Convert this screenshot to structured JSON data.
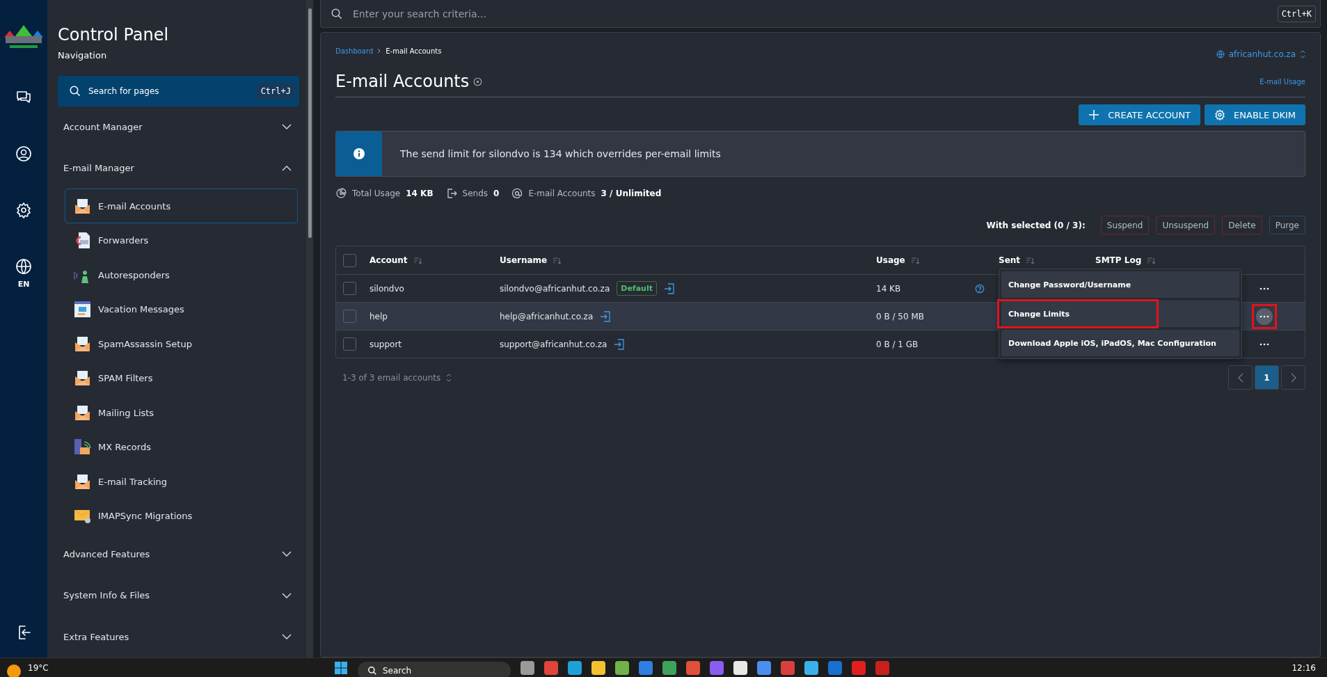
{
  "rail": {
    "language": "EN"
  },
  "sidebar": {
    "title": "Control Panel",
    "subtitle": "Navigation",
    "search": {
      "placeholder": "Search for pages",
      "shortcut": "Ctrl+J"
    },
    "sections": [
      {
        "label": "Account Manager",
        "expanded": false
      },
      {
        "label": "E-mail Manager",
        "expanded": true,
        "children": [
          {
            "label": "E-mail Accounts",
            "kind": "envelope",
            "selected": true
          },
          {
            "label": "Forwarders",
            "kind": "document",
            "selected": false
          },
          {
            "label": "Autoresponders",
            "kind": "person",
            "selected": false
          },
          {
            "label": "Vacation Messages",
            "kind": "calendar",
            "selected": false
          },
          {
            "label": "SpamAssassin Setup",
            "kind": "envelope",
            "selected": false
          },
          {
            "label": "SPAM Filters",
            "kind": "envelope",
            "selected": false
          },
          {
            "label": "Mailing Lists",
            "kind": "envelope",
            "selected": false
          },
          {
            "label": "MX Records",
            "kind": "server",
            "selected": false
          },
          {
            "label": "E-mail Tracking",
            "kind": "envelope",
            "selected": false
          },
          {
            "label": "IMAPSync Migrations",
            "kind": "closed-envelope",
            "selected": false
          }
        ]
      },
      {
        "label": "Advanced Features",
        "expanded": false
      },
      {
        "label": "System Info & Files",
        "expanded": false
      },
      {
        "label": "Extra Features",
        "expanded": false
      }
    ]
  },
  "search": {
    "placeholder": "Enter your search criteria...",
    "shortcut": "Ctrl+K"
  },
  "breadcrumb": [
    "Dashboard",
    "E-mail Accounts"
  ],
  "domain": "africanhut.co.za",
  "title": "E-mail Accounts",
  "usage_link": "E-mail Usage",
  "actions": [
    {
      "label": "CREATE ACCOUNT",
      "kind": "plus"
    },
    {
      "label": "ENABLE DKIM",
      "kind": "gear"
    }
  ],
  "notice": "The send limit for silondvo is 134 which overrides per-email limits",
  "stats": [
    {
      "kind": "pie",
      "label": "Total Usage",
      "value": "14 KB"
    },
    {
      "kind": "send",
      "label": "Sends",
      "value": "0"
    },
    {
      "kind": "at",
      "label": "E-mail Accounts",
      "value": "3 / Unlimited"
    }
  ],
  "bulk": {
    "label": "With selected (0 / 3):",
    "buttons": [
      {
        "label": "Suspend",
        "kind": "danger"
      },
      {
        "label": "Unsuspend",
        "kind": "danger"
      },
      {
        "label": "Delete",
        "kind": "danger"
      },
      {
        "label": "Purge",
        "kind": "primary"
      }
    ]
  },
  "table": {
    "select_all": false,
    "columns": [
      "Account",
      "Username",
      "Usage",
      "Sent",
      "SMTP Log"
    ],
    "rows": [
      {
        "account": "silondvo",
        "username": "silondvo@africanhut.co.za",
        "badge": "Default",
        "usage": "14 KB",
        "sent_info": true,
        "checked": false,
        "hovered": false,
        "menu_open": false,
        "annotated": false
      },
      {
        "account": "help",
        "username": "help@africanhut.co.za",
        "usage": "0 B / 50 MB",
        "sent_info": false,
        "checked": false,
        "hovered": true,
        "menu_open": true,
        "annotated": true
      },
      {
        "account": "support",
        "username": "support@africanhut.co.za",
        "usage": "0 B / 1 GB",
        "sent_info": false,
        "checked": false,
        "hovered": false,
        "menu_open": false,
        "annotated": false
      }
    ]
  },
  "menu": {
    "items": [
      {
        "label": "Change Password/Username",
        "annotated": false
      },
      {
        "label": "Change Limits",
        "annotated": true
      },
      {
        "label": "Download Apple iOS, iPadOS, Mac Configuration",
        "annotated": false
      }
    ]
  },
  "footer": {
    "count": "1-3 of 3 email accounts",
    "pages": [
      {
        "label": "1",
        "selected": true
      }
    ]
  },
  "taskbar": {
    "weather": "19°C",
    "search": "Search",
    "time": "12:16",
    "apps": [
      {
        "color": "#9a9a9a"
      },
      {
        "color": "#e0443a"
      },
      {
        "color": "#1fa0d8"
      },
      {
        "color": "#f2c230"
      },
      {
        "color": "#6fb24a"
      },
      {
        "color": "#2f7fe0"
      },
      {
        "color": "#3ea35a"
      },
      {
        "color": "#e0503a"
      },
      {
        "color": "#8a5cf0"
      },
      {
        "color": "#e8e8e8"
      },
      {
        "color": "#4a8ef0"
      },
      {
        "color": "#d84040"
      },
      {
        "color": "#3ab0e8"
      },
      {
        "color": "#1a6fd0"
      },
      {
        "color": "#e02020"
      },
      {
        "color": "#c8201c"
      }
    ]
  }
}
